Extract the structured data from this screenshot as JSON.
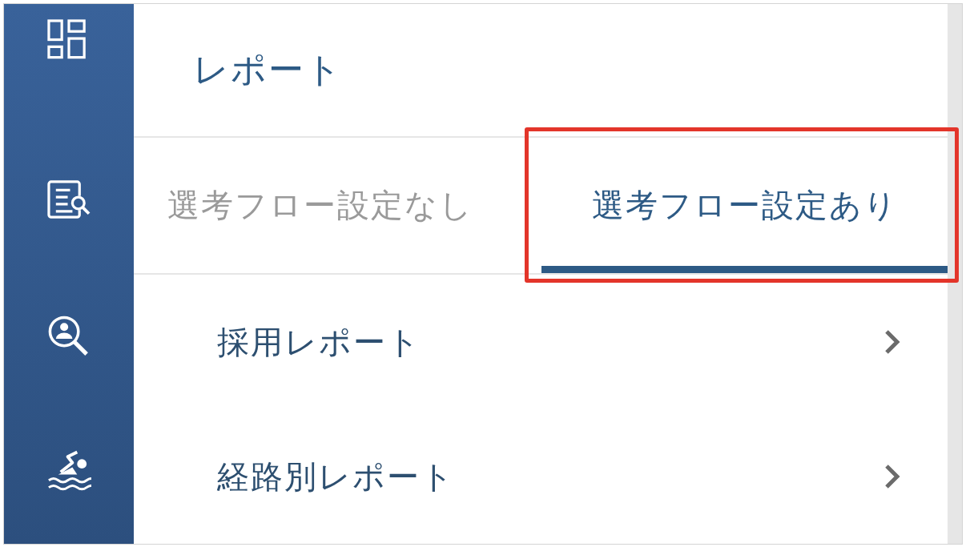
{
  "sidebar": {
    "items": [
      {
        "kind": "dashboard"
      },
      {
        "kind": "document-search"
      },
      {
        "kind": "person-search"
      },
      {
        "kind": "swimmer"
      }
    ]
  },
  "header": {
    "title": "レポート"
  },
  "tabs": [
    {
      "label": "選考フロー設定なし",
      "selected": false,
      "highlighted": false
    },
    {
      "label": "選考フロー設定あり",
      "selected": true,
      "highlighted": true
    }
  ],
  "menu": {
    "items": [
      {
        "label": "採用レポート"
      },
      {
        "label": "経路別レポート"
      }
    ]
  }
}
